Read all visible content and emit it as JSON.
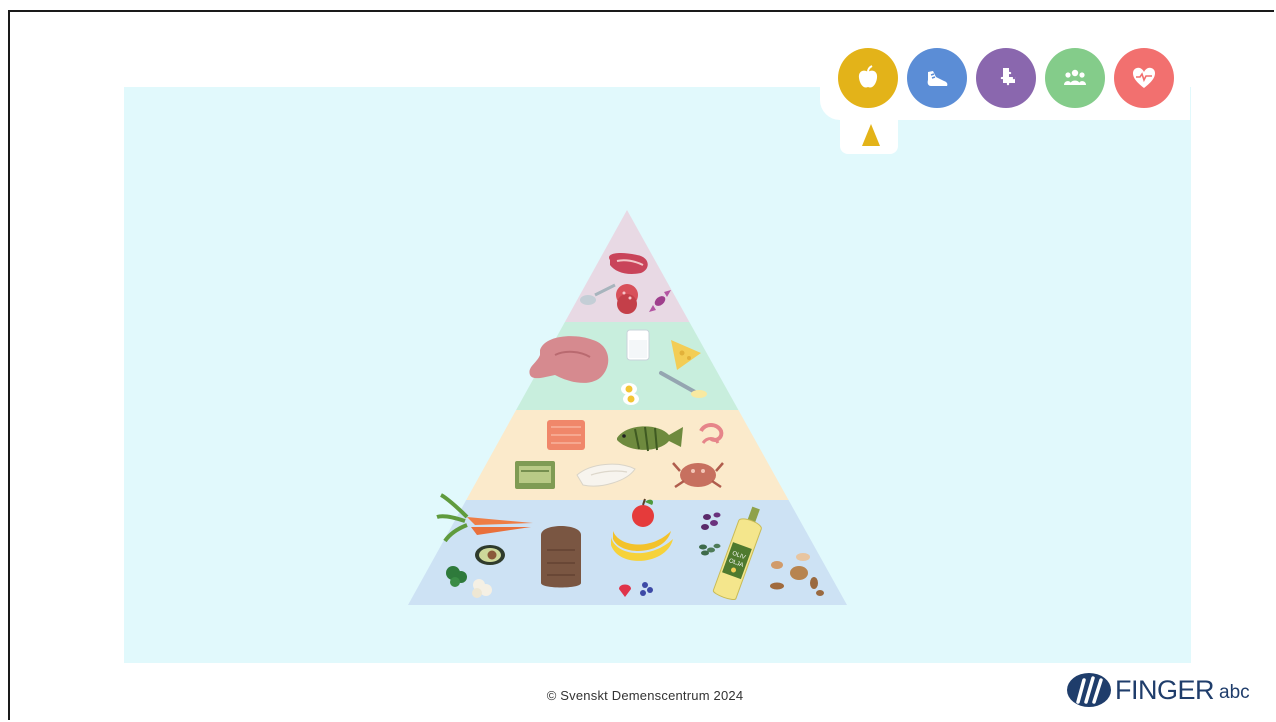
{
  "categories": [
    {
      "id": "diet",
      "icon": "apple-icon",
      "color": "#e3b319",
      "active": true
    },
    {
      "id": "exercise",
      "icon": "sneaker-icon",
      "color": "#5b8dd6"
    },
    {
      "id": "cognition",
      "icon": "puzzle-icon",
      "color": "#8a67ae"
    },
    {
      "id": "social",
      "icon": "group-icon",
      "color": "#84cc8a"
    },
    {
      "id": "heart-health",
      "icon": "heart-pulse-icon",
      "color": "#f2706f"
    }
  ],
  "pyramid": {
    "levels": [
      {
        "id": "top",
        "color": "#e8d9e4",
        "foods": [
          "red-meat",
          "spoon",
          "salami",
          "candy"
        ]
      },
      {
        "id": "upper-middle",
        "color": "#c8eedd",
        "foods": [
          "poultry",
          "milk",
          "cheese",
          "egg",
          "butter-knife"
        ]
      },
      {
        "id": "lower-middle",
        "color": "#fbeacb",
        "foods": [
          "salmon",
          "perch",
          "shrimp",
          "terrine",
          "white-fish",
          "crab"
        ]
      },
      {
        "id": "base",
        "color": "#cde2f4",
        "foods": [
          "carrots",
          "avocado",
          "broccoli",
          "cauliflower",
          "rye-bread",
          "apple",
          "bananas",
          "berries",
          "raisins",
          "seeds",
          "olive-oil-bottle",
          "nuts"
        ]
      }
    ],
    "oil_label": "OLIV\nOLJA"
  },
  "footer": {
    "copyright": "© Svenskt Demenscentrum 2024"
  },
  "brand": {
    "name": "FINGER",
    "sub": "abc",
    "color": "#1f3d6b"
  }
}
